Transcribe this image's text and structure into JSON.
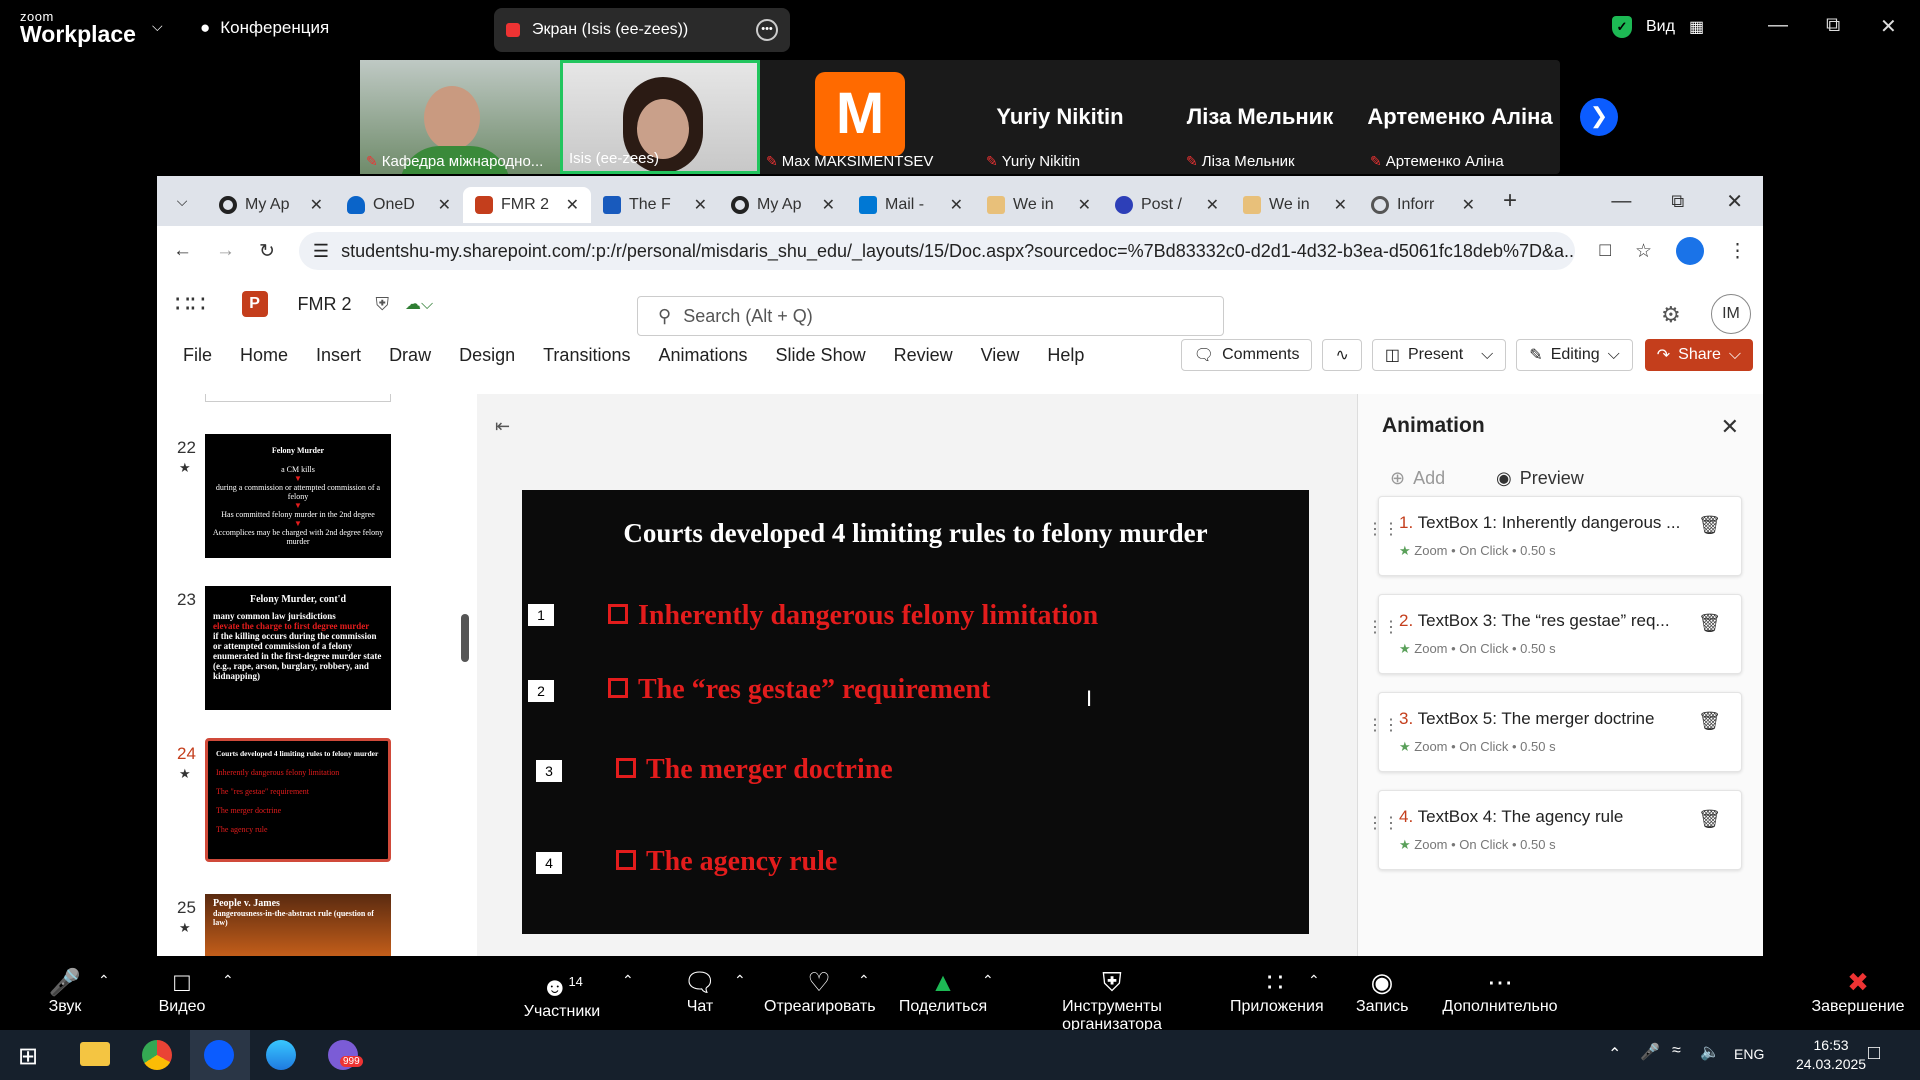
{
  "zoom": {
    "app": {
      "line1": "zoom",
      "line2": "Workplace"
    },
    "meeting_label": "Конференция",
    "screen_share": "Экран (Isis (ee-zees))",
    "view_label": "Вид",
    "participants": [
      {
        "name": "Кафедра міжнародно..."
      },
      {
        "name": "Isis (ee-zees)"
      },
      {
        "name": "Max MAKSIMENTSEV",
        "avatar_letter": "M",
        "avatar_color": "#ff6a00"
      },
      {
        "name": "Yuriy Nikitin"
      },
      {
        "name": "Ліза Мельник"
      },
      {
        "name": "Артеменко Аліна"
      }
    ],
    "toolbar": {
      "audio": "Звук",
      "video": "Видео",
      "participants": "Участники",
      "participants_count": "14",
      "chat": "Чат",
      "react": "Отреагировать",
      "share": "Поделиться",
      "host_tools": "Инструменты организатора",
      "apps": "Приложения",
      "record": "Запись",
      "more": "Дополнительно",
      "end": "Завершение"
    }
  },
  "browser": {
    "tabs": [
      {
        "label": "My Ap",
        "icon": "circle-o-icon",
        "color": "#222"
      },
      {
        "label": "OneD",
        "icon": "onedrive-icon",
        "color": "#0a64c9"
      },
      {
        "label": "FMR 2",
        "icon": "powerpoint-icon",
        "color": "#c43e1c",
        "active": true
      },
      {
        "label": "The F",
        "icon": "word-icon",
        "color": "#185abd"
      },
      {
        "label": "My Ap",
        "icon": "circle-o-icon",
        "color": "#222"
      },
      {
        "label": "Mail -",
        "icon": "outlook-icon",
        "color": "#0078d4"
      },
      {
        "label": "We in",
        "icon": "doc-icon",
        "color": "#e8c07a"
      },
      {
        "label": "Post /",
        "icon": "zm-icon",
        "color": "#2d3fb8"
      },
      {
        "label": "We in",
        "icon": "doc-icon",
        "color": "#e8c07a"
      },
      {
        "label": "Inforr",
        "icon": "globe-icon",
        "color": "#555"
      }
    ],
    "url": "studentshu-my.sharepoint.com/:p:/r/personal/misdaris_shu_edu/_layouts/15/Doc.aspx?sourcedoc=%7Bd83332c0-d2d1-4d32-b3ea-d5061fc18deb%7D&a..."
  },
  "ppt": {
    "doc_name": "FMR 2",
    "search_placeholder": "Search (Alt + Q)",
    "user_initials": "IM",
    "ribbon_tabs": [
      "File",
      "Home",
      "Insert",
      "Draw",
      "Design",
      "Transitions",
      "Animations",
      "Slide Show",
      "Review",
      "View",
      "Help"
    ],
    "comments": "Comments",
    "present": "Present",
    "editing": "Editing",
    "share": "Share",
    "slides": [
      {
        "num": "22",
        "lines": [
          "Felony Murder",
          "a CM kills",
          "during a commission or attempted commission of a felony",
          "Has committed felony murder in the 2nd degree",
          "Accomplices may be charged with 2nd degree felony murder"
        ]
      },
      {
        "num": "23",
        "lines": [
          "Felony Murder, cont'd",
          "many common law jurisdictions",
          "elevate the charge to first degree murder",
          "if the killing occurs during the commission or attempted commission of a felony enumerated in the first-degree murder state (e.g., rape, arson, burglary, robbery, and kidnapping)"
        ]
      },
      {
        "num": "24",
        "lines": [
          "Courts developed 4 limiting rules to felony murder",
          "Inherently dangerous felony limitation",
          "The \"res gestae\" requirement",
          "The merger doctrine",
          "The agency rule"
        ]
      },
      {
        "num": "25",
        "lines": [
          "People v. James",
          "dangerousness-in-the-abstract rule (question of law)"
        ]
      }
    ],
    "slide": {
      "title": "Courts developed 4 limiting rules to felony murder",
      "bullets": [
        {
          "order": "1",
          "text": "Inherently dangerous felony limitation"
        },
        {
          "order": "2",
          "text": "The “res gestae” requirement"
        },
        {
          "order": "3",
          "text": "The merger doctrine"
        },
        {
          "order": "4",
          "text": "The agency rule"
        }
      ]
    },
    "animation": {
      "title": "Animation",
      "add": "Add",
      "preview": "Preview",
      "items": [
        {
          "idx": "1.",
          "label": "TextBox 1: Inherently dangerous ...",
          "sub": "Zoom • On Click • 0.50 s"
        },
        {
          "idx": "2.",
          "label": "TextBox 3: The “res gestae” req...",
          "sub": "Zoom • On Click • 0.50 s"
        },
        {
          "idx": "3.",
          "label": "TextBox 5: The merger doctrine",
          "sub": "Zoom • On Click • 0.50 s"
        },
        {
          "idx": "4.",
          "label": "TextBox 4: The agency rule",
          "sub": "Zoom • On Click • 0.50 s"
        }
      ]
    }
  },
  "taskbar": {
    "lang": "ENG",
    "time": "16:53",
    "date": "24.03.2025",
    "viber_badge": "999"
  }
}
